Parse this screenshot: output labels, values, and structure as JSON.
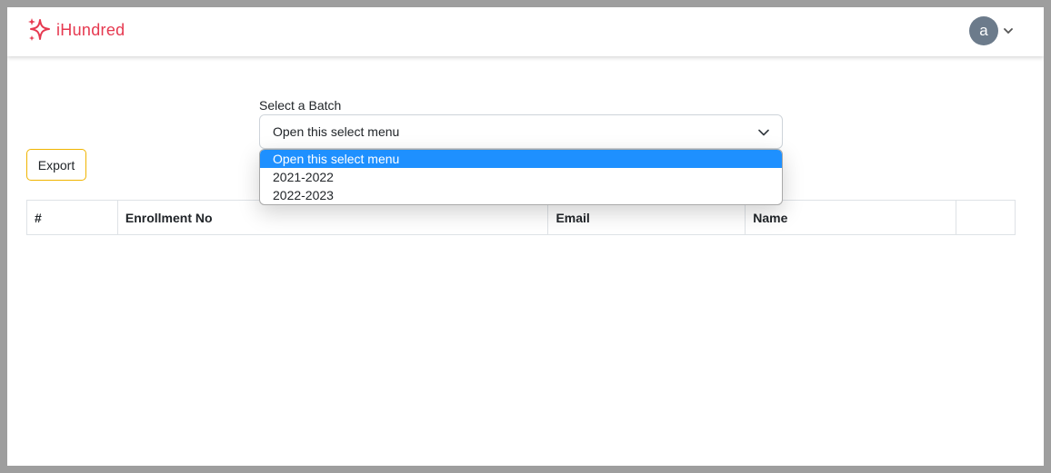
{
  "brand": {
    "name": "iHundred",
    "color": "#e63950"
  },
  "user": {
    "initial": "a",
    "avatar_color": "#6c7b8b"
  },
  "batch_select": {
    "label": "Select a Batch",
    "value": "Open this select menu",
    "options": [
      {
        "label": "Open this select menu",
        "selected": true
      },
      {
        "label": "2021-2022",
        "selected": false
      },
      {
        "label": "2022-2023",
        "selected": false
      }
    ]
  },
  "toolbar": {
    "export_label": "Export"
  },
  "table": {
    "headers": [
      "#",
      "Enrollment No",
      "Email",
      "Name",
      ""
    ],
    "rows": []
  }
}
